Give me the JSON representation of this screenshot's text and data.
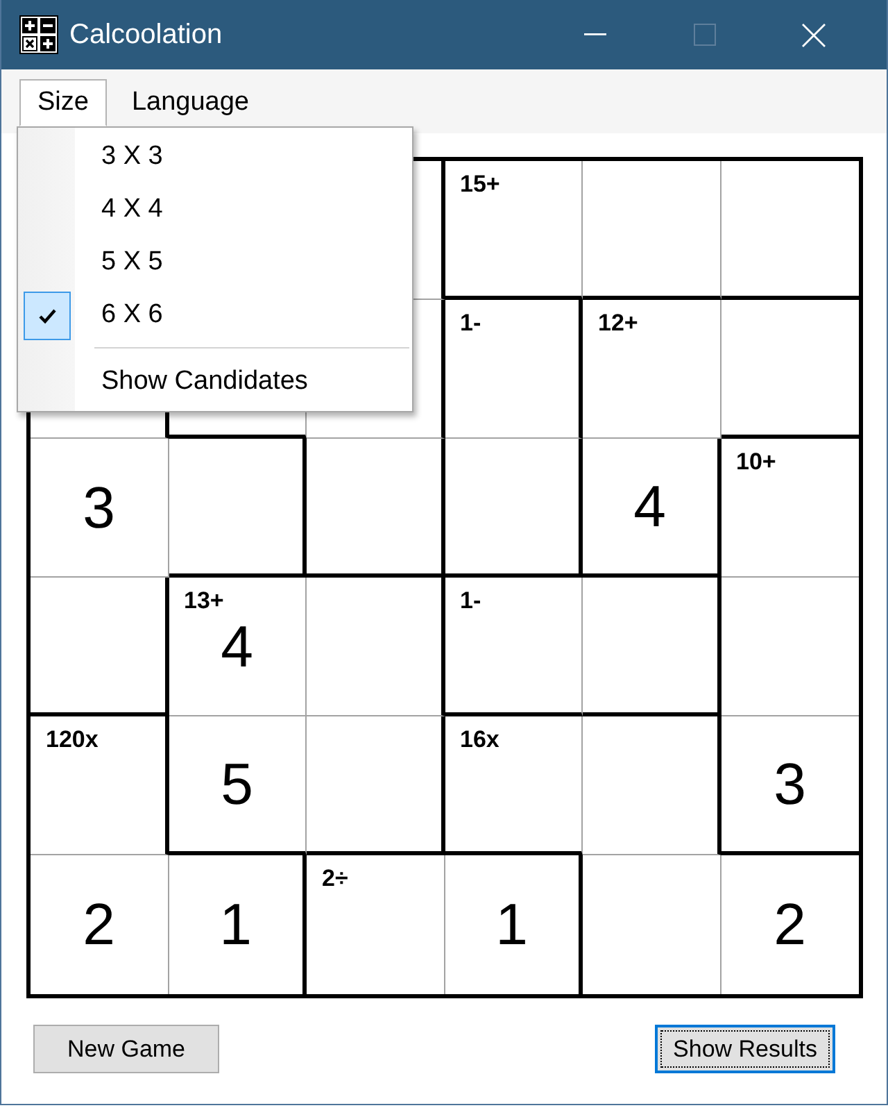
{
  "window": {
    "title": "Calcoolation",
    "caption_buttons": [
      {
        "kind": "minimize",
        "disabled": false
      },
      {
        "kind": "maximize",
        "disabled": true
      },
      {
        "kind": "close",
        "disabled": false
      }
    ]
  },
  "menu_bar": [
    {
      "label": "Size",
      "selected": true,
      "items": [
        {
          "kind": "option",
          "label": "3 X 3",
          "checked": false
        },
        {
          "kind": "option",
          "label": "4 X 4",
          "checked": false
        },
        {
          "kind": "option",
          "label": "5 X 5",
          "checked": false
        },
        {
          "kind": "option",
          "label": "6 X 6",
          "checked": true
        },
        {
          "kind": "separator"
        },
        {
          "kind": "option",
          "label": "Show Candidates",
          "checked": false
        }
      ]
    },
    {
      "label": "Language",
      "selected": false
    }
  ],
  "grid": {
    "rows": [
      [
        null,
        null,
        {
          "wall_right": true,
          "wall_bottom": false
        },
        {
          "clue": "15+",
          "wall_right": false,
          "wall_bottom": true
        },
        {
          "wall_right": false,
          "wall_bottom": true
        },
        {
          "wall_bottom": true
        }
      ],
      [
        {
          "wall_right": true,
          "wall_bottom": false
        },
        {
          "wall_right": false,
          "wall_bottom": true
        },
        {
          "wall_right": true,
          "wall_bottom": false
        },
        {
          "clue": "1-",
          "wall_right": true,
          "wall_bottom": false
        },
        {
          "clue": "12+",
          "wall_right": false,
          "wall_bottom": false
        },
        {
          "wall_bottom": true
        }
      ],
      [
        {
          "value": "3",
          "wall_right": false,
          "wall_bottom": false
        },
        {
          "wall_right": true,
          "wall_bottom": true
        },
        {
          "wall_right": true,
          "wall_bottom": true
        },
        {
          "wall_right": true,
          "wall_bottom": true
        },
        {
          "value": "4",
          "wall_right": true,
          "wall_bottom": true
        },
        {
          "clue": "10+",
          "wall_bottom": false
        }
      ],
      [
        {
          "wall_right": true,
          "wall_bottom": true
        },
        {
          "clue": "13+",
          "value": "4",
          "wall_right": false,
          "wall_bottom": false
        },
        {
          "wall_right": true,
          "wall_bottom": false
        },
        {
          "clue": "1-",
          "wall_right": false,
          "wall_bottom": true
        },
        {
          "wall_right": true,
          "wall_bottom": true
        },
        {
          "wall_bottom": false
        }
      ],
      [
        {
          "clue": "120x",
          "wall_right": true,
          "wall_bottom": false
        },
        {
          "value": "5",
          "wall_right": false,
          "wall_bottom": true
        },
        {
          "wall_right": true,
          "wall_bottom": true
        },
        {
          "clue": "16x",
          "wall_right": false,
          "wall_bottom": true
        },
        {
          "wall_right": true,
          "wall_bottom": false
        },
        {
          "value": "3",
          "wall_bottom": true
        }
      ],
      [
        {
          "value": "2",
          "wall_right": false
        },
        {
          "value": "1",
          "wall_right": true
        },
        {
          "clue": "2÷",
          "wall_right": false
        },
        {
          "value": "1",
          "wall_right": true
        },
        {
          "wall_right": false
        },
        {
          "value": "2"
        }
      ]
    ]
  },
  "buttons": [
    {
      "label": "New Game",
      "focused": false
    },
    {
      "label": "Show Results",
      "focused": true
    }
  ]
}
